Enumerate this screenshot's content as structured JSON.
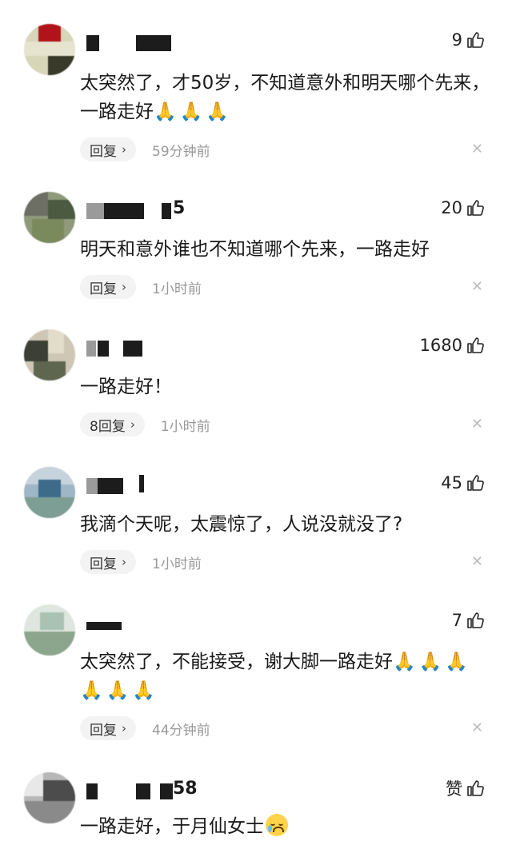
{
  "colors": {
    "text": "#1a1a1a",
    "meta": "#999999",
    "reply_bg": "#f3f3f3",
    "emoji": "#e3a34a"
  },
  "comments": [
    {
      "likes": "9",
      "text": "太突然了，才50岁，不知道意外和明天哪个先来，一路走好",
      "emoji": "🙏🙏🙏",
      "reply_label": "回复",
      "time": "59分钟前"
    },
    {
      "name_suffix": "5",
      "likes": "20",
      "text": "明天和意外谁也不知道哪个先来，一路走好",
      "reply_label": "回复",
      "time": "1小时前"
    },
    {
      "likes": "1680",
      "text": "一路走好！",
      "reply_label": "8回复",
      "time": "1小时前"
    },
    {
      "likes": "45",
      "text": "我滴个天呢，太震惊了，人说没就没了?",
      "reply_label": "回复",
      "time": "1小时前"
    },
    {
      "likes": "7",
      "text": "太突然了，不能接受，谢大脚一路走好",
      "emoji": "🙏🙏🙏🙏🙏🙏",
      "reply_label": "回复",
      "time": "44分钟前"
    },
    {
      "name_suffix": "58",
      "likes": "赞",
      "text": "一路走好，于月仙女士",
      "emoji_face": "crying-face"
    }
  ],
  "icons": {
    "like": "thumbs-up-icon",
    "close": "close-icon",
    "reply_arrow": "chevron-right-icon",
    "prayer": "folded-hands-icon"
  }
}
